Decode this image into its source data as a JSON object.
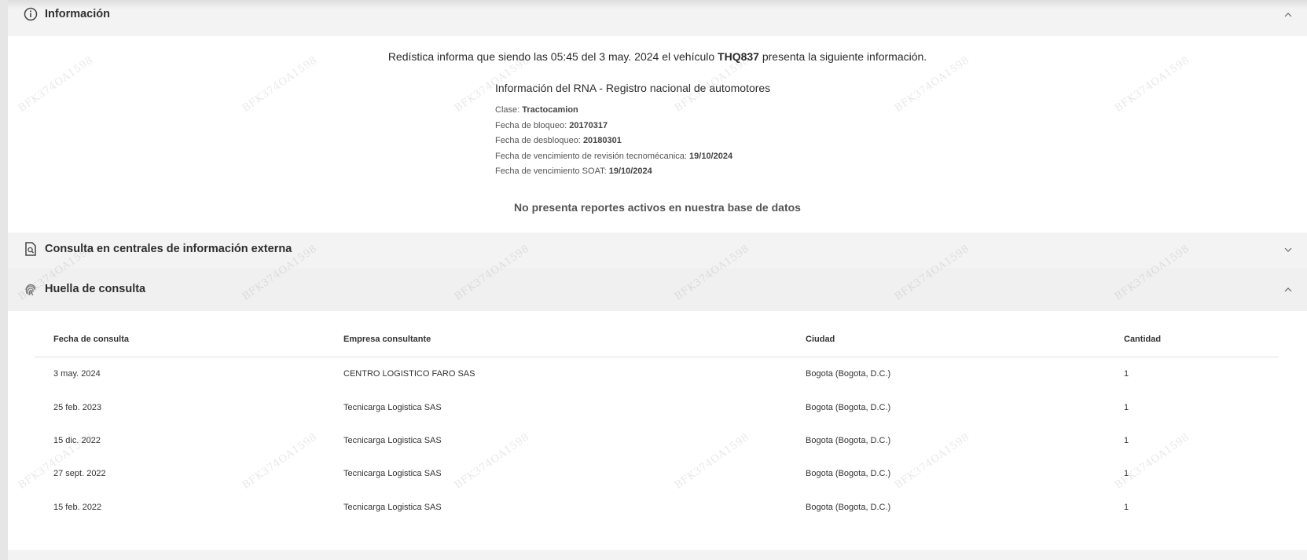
{
  "sections": {
    "informacion": {
      "title": "Información",
      "icon": "info-circle-icon",
      "expanded": true
    },
    "centrales": {
      "title": "Consulta en centrales de información externa",
      "icon": "document-search-icon",
      "expanded": false
    },
    "huella": {
      "title": "Huella de consulta",
      "icon": "fingerprint-icon",
      "expanded": true
    }
  },
  "intro": {
    "prefix": "Redística informa que siendo las 05:45 del 3 may. 2024 el vehículo",
    "plate": "THQ837",
    "suffix": "presenta la siguiente información."
  },
  "rna": {
    "title": "Información del RNA - Registro nacional de automotores",
    "fields": [
      {
        "label": "Clase:",
        "value": "Tractocamion"
      },
      {
        "label": "Fecha de bloqueo:",
        "value": "20170317"
      },
      {
        "label": "Fecha de desbloqueo:",
        "value": "20180301"
      },
      {
        "label": "Fecha de vencimiento de revisión tecnomécanica:",
        "value": "19/10/2024"
      },
      {
        "label": "Fecha de vencimiento SOAT:",
        "value": "19/10/2024"
      }
    ]
  },
  "no_reports": "No presenta reportes activos en nuestra base de datos",
  "watermark": "BFK374OA1598",
  "table": {
    "headers": [
      "Fecha de consulta",
      "Empresa consultante",
      "Ciudad",
      "Cantidad"
    ],
    "rows": [
      [
        "3 may. 2024",
        "CENTRO LOGISTICO FARO SAS",
        "Bogota (Bogota, D.C.)",
        "1"
      ],
      [
        "25 feb. 2023",
        "Tecnicarga Logistica SAS",
        "Bogota (Bogota, D.C.)",
        "1"
      ],
      [
        "15 dic. 2022",
        "Tecnicarga Logistica SAS",
        "Bogota (Bogota, D.C.)",
        "1"
      ],
      [
        "27 sept. 2022",
        "Tecnicarga Logistica SAS",
        "Bogota (Bogota, D.C.)",
        "1"
      ],
      [
        "15 feb. 2022",
        "Tecnicarga Logistica SAS",
        "Bogota (Bogota, D.C.)",
        "1"
      ]
    ]
  }
}
